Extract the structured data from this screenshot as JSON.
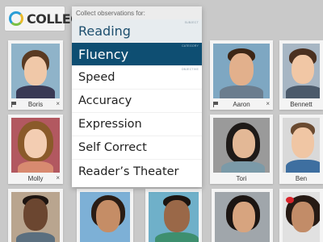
{
  "app": {
    "logo_text": "COLLECT"
  },
  "menu": {
    "header": "Collect observations for:",
    "items": [
      {
        "label": "Reading",
        "tag": "SUBJECT",
        "state": "subject"
      },
      {
        "label": "Fluency",
        "tag": "CATEGORY",
        "state": "selected"
      },
      {
        "label": "Speed",
        "tag": "OBJECTIVE",
        "state": "normal"
      },
      {
        "label": "Accuracy",
        "tag": "",
        "state": "normal"
      },
      {
        "label": "Expression",
        "tag": "",
        "state": "normal"
      },
      {
        "label": "Self Correct",
        "tag": "",
        "state": "normal"
      },
      {
        "label": "Reader’s Theater",
        "tag": "",
        "state": "normal"
      }
    ]
  },
  "students": [
    {
      "name": "Boris",
      "flag": true,
      "remove": true
    },
    {
      "name": "Aaron",
      "flag": true,
      "remove": true
    },
    {
      "name": "Bennett",
      "flag": false,
      "remove": false
    },
    {
      "name": "Molly",
      "flag": false,
      "remove": true
    },
    {
      "name": "Tori",
      "flag": false,
      "remove": false
    },
    {
      "name": "Ben",
      "flag": false,
      "remove": false
    }
  ],
  "icons": {
    "flag": "flag-icon",
    "remove": "close-icon",
    "logo": "collect-logo-icon"
  },
  "colors": {
    "selected_bg": "#0e4e72",
    "subject_bg": "#e7ecef",
    "page_bg": "#c9c9c9"
  }
}
